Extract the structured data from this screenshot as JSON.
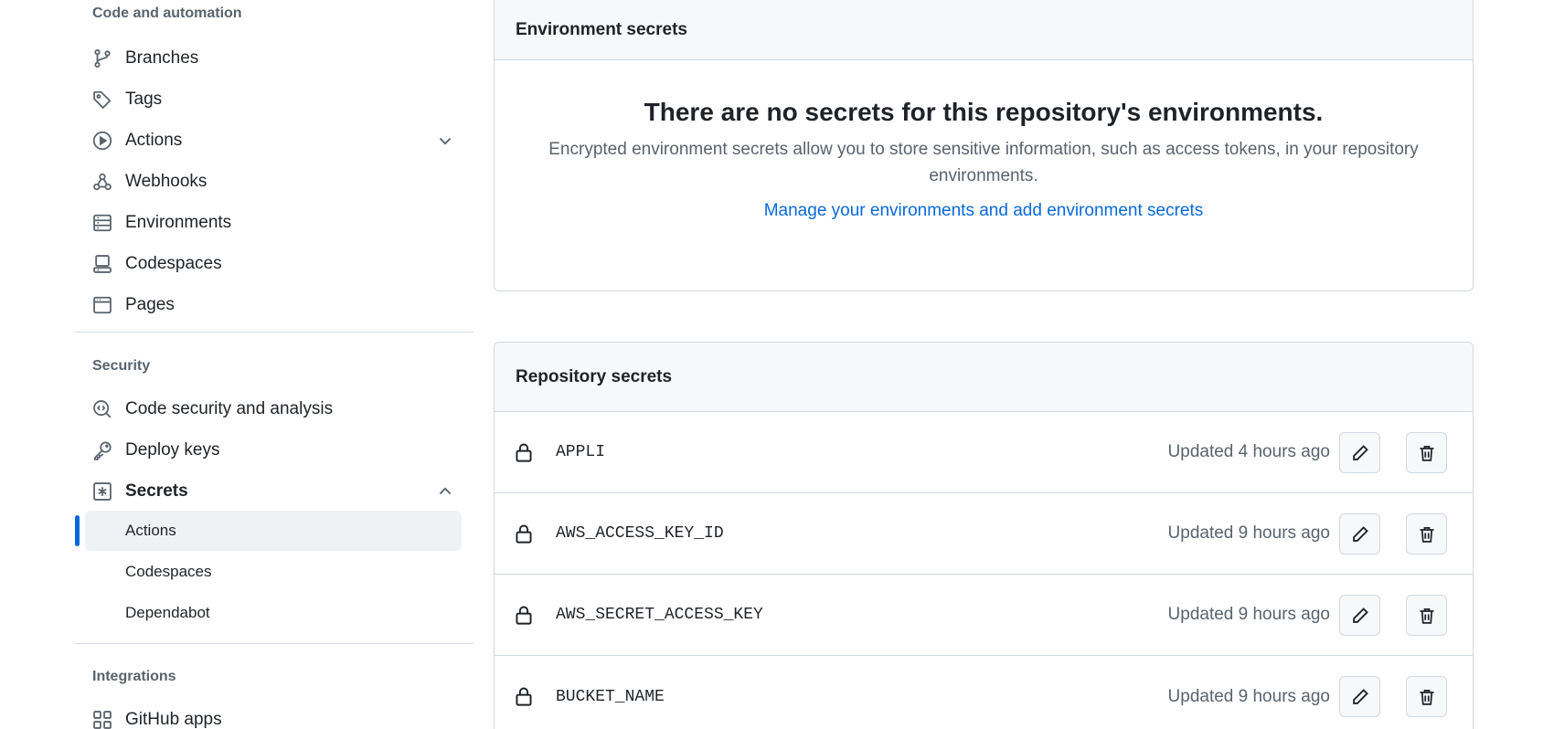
{
  "sidebar": {
    "code_heading": "Code and automation",
    "code_items": [
      {
        "label": "Branches",
        "icon": "branch-icon"
      },
      {
        "label": "Tags",
        "icon": "tag-icon"
      },
      {
        "label": "Actions",
        "icon": "play-icon"
      },
      {
        "label": "Webhooks",
        "icon": "webhook-icon"
      },
      {
        "label": "Environments",
        "icon": "server-icon"
      },
      {
        "label": "Codespaces",
        "icon": "codespaces-icon"
      },
      {
        "label": "Pages",
        "icon": "browser-icon"
      }
    ],
    "security_heading": "Security",
    "security_items": [
      {
        "label": "Code security and analysis",
        "icon": "codescan-icon"
      },
      {
        "label": "Deploy keys",
        "icon": "key-icon"
      },
      {
        "label": "Secrets",
        "icon": "asterisk-icon"
      }
    ],
    "secrets_sub_items": [
      {
        "label": "Actions",
        "active": true
      },
      {
        "label": "Codespaces",
        "active": false
      },
      {
        "label": "Dependabot",
        "active": false
      }
    ],
    "integrations_heading": "Integrations",
    "integrations_items": [
      {
        "label": "GitHub apps",
        "icon": "apps-icon"
      }
    ]
  },
  "environment_secrets": {
    "title": "Environment secrets",
    "blank_title": "There are no secrets for this repository's environments.",
    "blank_text": "Encrypted environment secrets allow you to store sensitive information, such as access tokens, in your repository environments.",
    "link": "Manage your environments and add environment secrets"
  },
  "repository_secrets": {
    "title": "Repository secrets",
    "items": [
      {
        "name": "APPLI",
        "updated": "Updated 4 hours ago"
      },
      {
        "name": "AWS_ACCESS_KEY_ID",
        "updated": "Updated 9 hours ago"
      },
      {
        "name": "AWS_SECRET_ACCESS_KEY",
        "updated": "Updated 9 hours ago"
      },
      {
        "name": "BUCKET_NAME",
        "updated": "Updated 9 hours ago"
      }
    ]
  },
  "colors": {
    "accent": "#0969da",
    "text": "#1f2328",
    "muted": "#59636e",
    "border": "#d1d9e0"
  }
}
